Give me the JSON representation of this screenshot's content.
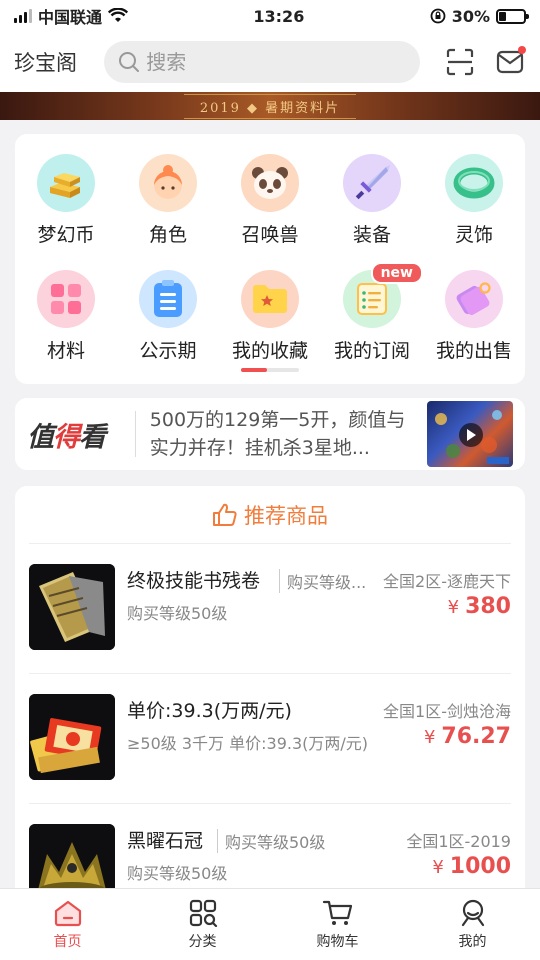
{
  "status_bar": {
    "carrier": "中国联通",
    "time": "13:26",
    "battery": "30%",
    "battery_level": 0.3
  },
  "header": {
    "app_title": "珍宝阁",
    "search_placeholder": "搜索",
    "scan_icon": "scan-icon",
    "mail_icon": "mail-icon"
  },
  "banner": {
    "text": "2019 ◆ 暑期资料片"
  },
  "categories": [
    {
      "label": "梦幻币",
      "icon": "gold-bars-icon"
    },
    {
      "label": "角色",
      "icon": "character-icon"
    },
    {
      "label": "召唤兽",
      "icon": "panda-icon"
    },
    {
      "label": "装备",
      "icon": "sword-icon"
    },
    {
      "label": "灵饰",
      "icon": "jade-ring-icon"
    },
    {
      "label": "材料",
      "icon": "materials-icon"
    },
    {
      "label": "公示期",
      "icon": "notice-icon"
    },
    {
      "label": "我的收藏",
      "icon": "folder-star-icon"
    },
    {
      "label": "我的订阅",
      "icon": "subscription-icon",
      "badge": "new"
    },
    {
      "label": "我的出售",
      "icon": "sale-tag-icon"
    }
  ],
  "news": {
    "logo_part1": "值",
    "logo_part2": "得",
    "logo_part3": "看",
    "text": "500万的129第一5开，颜值与实力并存！挂机杀3星地..."
  },
  "recommend": {
    "title": "推荐商品",
    "products": [
      {
        "name": "终极技能书残卷",
        "tag": "购买等级...",
        "server": "全国2区-逐鹿天下",
        "desc": "购买等级50级",
        "currency": "¥",
        "price": "380"
      },
      {
        "name": "单价:39.3(万两/元)",
        "tag": "",
        "server": "全国1区-剑烛沧海",
        "desc": "≥50级 3千万 单价:39.3(万两/元)",
        "currency": "¥",
        "price": "76.27"
      },
      {
        "name": "黑曜石冠",
        "tag": "购买等级50级",
        "server": "全国1区-2019",
        "desc": "购买等级50级",
        "currency": "¥",
        "price": "1000"
      }
    ]
  },
  "tab_bar": {
    "tabs": [
      {
        "label": "首页",
        "icon": "home-icon",
        "active": true
      },
      {
        "label": "分类",
        "icon": "category-icon",
        "active": false
      },
      {
        "label": "购物车",
        "icon": "cart-icon",
        "active": false
      },
      {
        "label": "我的",
        "icon": "profile-icon",
        "active": false
      }
    ]
  },
  "colors": {
    "accent": "#e85050",
    "recommend_title": "#f07d3c"
  }
}
